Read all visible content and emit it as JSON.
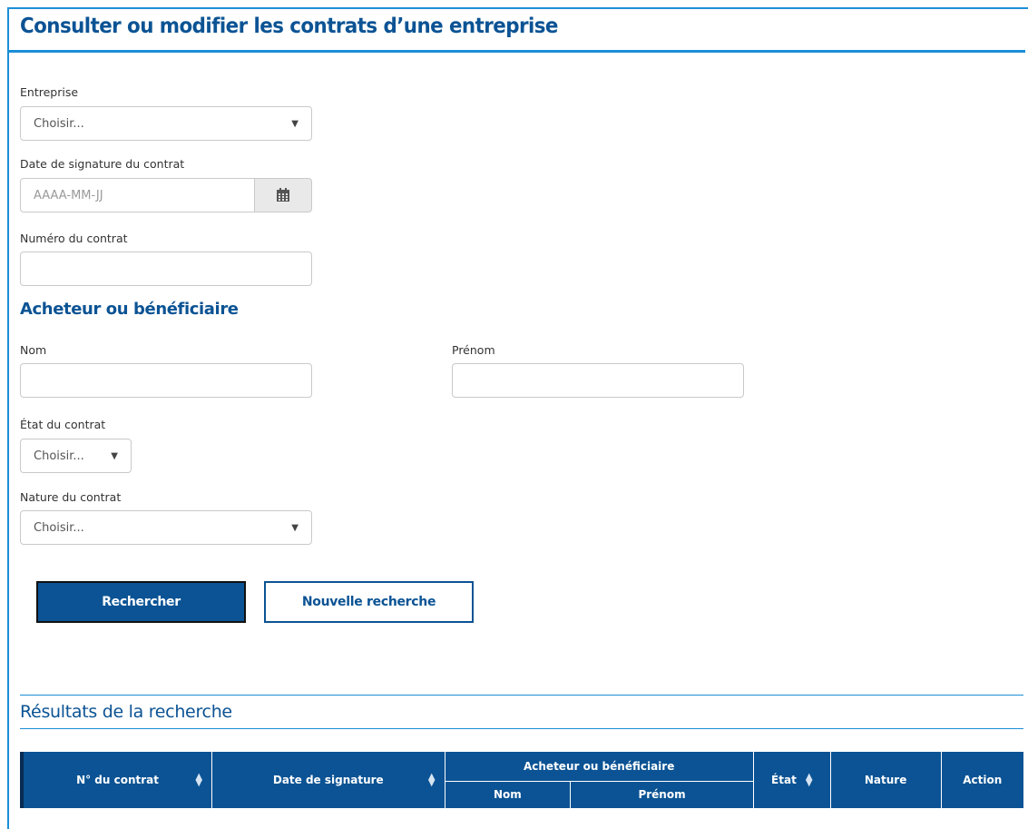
{
  "page_title": "Consulter ou modifier les contrats d’une entreprise",
  "form": {
    "entreprise": {
      "label": "Entreprise",
      "value": "Choisir..."
    },
    "date_signature": {
      "label": "Date de signature du contrat",
      "placeholder": "AAAA-MM-JJ"
    },
    "numero": {
      "label": "Numéro du contrat",
      "value": ""
    },
    "acheteur_heading": "Acheteur ou bénéficiaire",
    "nom": {
      "label": "Nom",
      "value": ""
    },
    "prenom": {
      "label": "Prénom",
      "value": ""
    },
    "etat": {
      "label": "État du contrat",
      "value": "Choisir..."
    },
    "nature": {
      "label": "Nature du contrat",
      "value": "Choisir..."
    }
  },
  "buttons": {
    "search": "Rechercher",
    "new_search": "Nouvelle recherche"
  },
  "results": {
    "title": "Résultats de la recherche",
    "columns": {
      "numero": "N° du contrat",
      "date": "Date de signature",
      "acheteur": "Acheteur ou bénéficiaire",
      "nom": "Nom",
      "prenom": "Prénom",
      "etat": "État",
      "nature": "Nature",
      "action": "Action"
    }
  },
  "colors": {
    "primary": "#0b5394",
    "accent": "#1b8ed6"
  }
}
